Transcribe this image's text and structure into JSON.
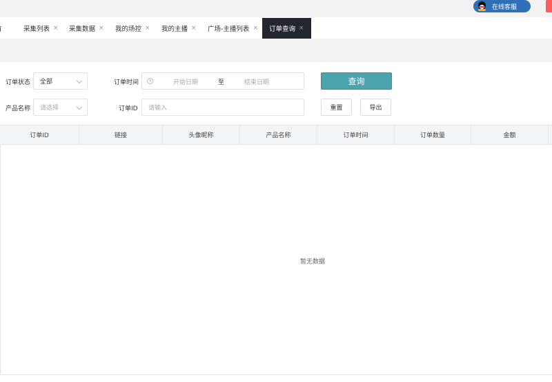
{
  "header": {
    "customer_service_label": "在线客服"
  },
  "tabs": [
    {
      "label": "采集列表",
      "close": "×"
    },
    {
      "label": "采集数据",
      "close": "×"
    },
    {
      "label": "我的场控",
      "close": "×"
    },
    {
      "label": "我的主播",
      "close": "×"
    },
    {
      "label": "广场-主播列表",
      "close": "×"
    },
    {
      "label": "订单查询",
      "close": "×",
      "active": true
    }
  ],
  "tab_partial": "首",
  "filters": {
    "order_status_label": "订单状态",
    "order_status_value": "全部",
    "order_time_label": "订单时间",
    "start_date_placeholder": "开始日期",
    "range_separator": "至",
    "end_date_placeholder": "结束日期",
    "product_name_label": "产品名称",
    "product_name_placeholder": "请选择",
    "order_id_label": "订单ID",
    "order_id_placeholder": "请输入"
  },
  "actions": {
    "query": "查询",
    "reset": "重置",
    "export": "导出"
  },
  "table": {
    "columns": [
      "订单ID",
      "链接",
      "头像昵称",
      "产品名称",
      "订单时间",
      "订单数量",
      "金额"
    ],
    "empty_text": "暂无数据"
  },
  "colors": {
    "accent": "#4ba3b0",
    "active_tab": "#23262e",
    "cs_button": "#2f6fb6"
  }
}
